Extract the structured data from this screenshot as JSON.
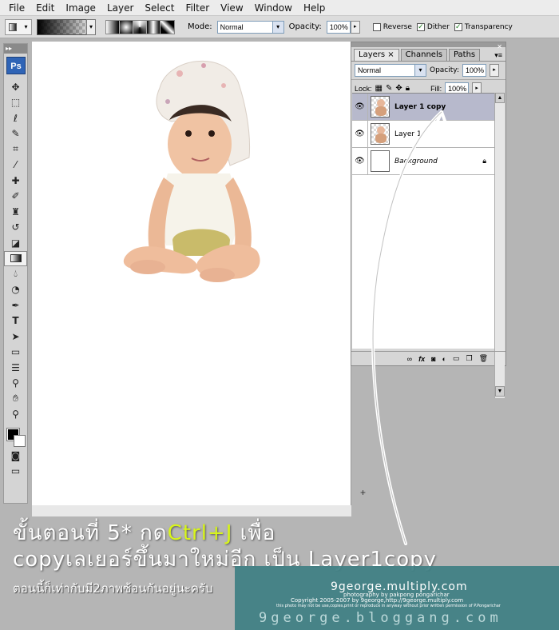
{
  "menu": [
    "File",
    "Edit",
    "Image",
    "Layer",
    "Select",
    "Filter",
    "View",
    "Window",
    "Help"
  ],
  "options": {
    "mode_label": "Mode:",
    "mode_value": "Normal",
    "opacity_label": "Opacity:",
    "opacity_value": "100%",
    "reverse_label": "Reverse",
    "reverse_checked": false,
    "dither_label": "Dither",
    "dither_checked": true,
    "transparency_label": "Transparency",
    "transparency_checked": true
  },
  "toolbox": {
    "logo": "Ps",
    "tools": [
      "move-icon",
      "marquee-icon",
      "lasso-icon",
      "quick-select-icon",
      "crop-icon",
      "slice-icon",
      "healing-icon",
      "brush-icon",
      "stamp-icon",
      "history-brush-icon",
      "eraser-icon",
      "gradient-icon",
      "blur-icon",
      "dodge-icon",
      "pen-icon",
      "type-icon",
      "path-select-icon",
      "shape-icon",
      "notes-icon",
      "eyedropper-icon",
      "hand-icon",
      "zoom-icon"
    ]
  },
  "layers_panel": {
    "tabs": [
      "Layers",
      "Channels",
      "Paths"
    ],
    "active_tab": "Layers",
    "blend_mode": "Normal",
    "opacity_label": "Opacity:",
    "opacity_value": "100%",
    "lock_label": "Lock:",
    "fill_label": "Fill:",
    "fill_value": "100%",
    "layers": [
      {
        "name": "Layer 1 copy",
        "selected": true
      },
      {
        "name": "Layer 1",
        "selected": false
      },
      {
        "name": "Background",
        "selected": false,
        "locked": true
      }
    ]
  },
  "caption": {
    "line1_a": "ขั้นตอนที่ 5* กด",
    "line1_hl": "Ctrl+J",
    "line1_b": " เพื่อ",
    "line2": "copyเลเยอร์ขึ้นมาใหม่อีก เป็น Layer1copy",
    "line3": "ตอนนี้ก็เท่ากับมี2ภาพซ้อนกันอยู่นะครับ"
  },
  "watermark": {
    "site": "9george.multiply.com",
    "credit": "photography by pakpong pongarichar",
    "copyright": "Copyright 2005-2007 by 9george,http://9george.multiply.com",
    "notice": "this photo may not be use,copies,print or reproduce in anyway without prior written permission of P.Pongarichar",
    "blog": "9george.bloggang.com"
  },
  "colors": {
    "highlight": "#d8f51a",
    "selected_layer": "#b7b9cc",
    "watermark_bg": "#3e7f83",
    "ps_logo": "#2f64b6"
  }
}
